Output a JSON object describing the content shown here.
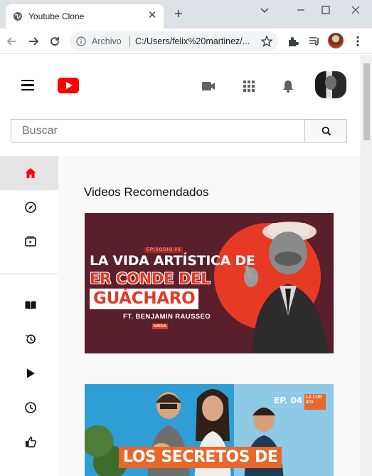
{
  "browser": {
    "tab_title": "Youtube Clone",
    "omnibox_label": "Archivo",
    "omnibox_url": "C:/Users/felix%20martinez/..."
  },
  "page": {
    "search": {
      "placeholder": "Buscar",
      "value": ""
    },
    "section_title": "Videos Recomendados",
    "sidebar": {
      "items": [
        {
          "icon": "home-icon",
          "active": true
        },
        {
          "icon": "compass-icon"
        },
        {
          "icon": "subscriptions-icon"
        },
        {
          "icon": "library-icon"
        },
        {
          "icon": "history-icon"
        },
        {
          "icon": "play-icon"
        },
        {
          "icon": "clock-icon"
        },
        {
          "icon": "thumbs-up-icon"
        }
      ]
    },
    "videos": [
      {
        "thumb_small": "EPISODIO #3",
        "thumb_line1": "LA VIDA ARTÍSTICA DE",
        "thumb_line2": "ER CONDE DEL",
        "thumb_line3": "GUÁCHARO",
        "thumb_line4": "FT. BENJAMIN RAUSSEO",
        "thumb_badge": "NAIGA"
      },
      {
        "thumb_ep": "EP. 04",
        "thumb_logo": "LA CUR ICO",
        "thumb_title": "LOS SECRETOS DE"
      }
    ]
  },
  "colors": {
    "brand_red": "#ff0000",
    "active_icon_red": "#ff0000",
    "sidebar_active_bg": "#e5e5e5"
  }
}
